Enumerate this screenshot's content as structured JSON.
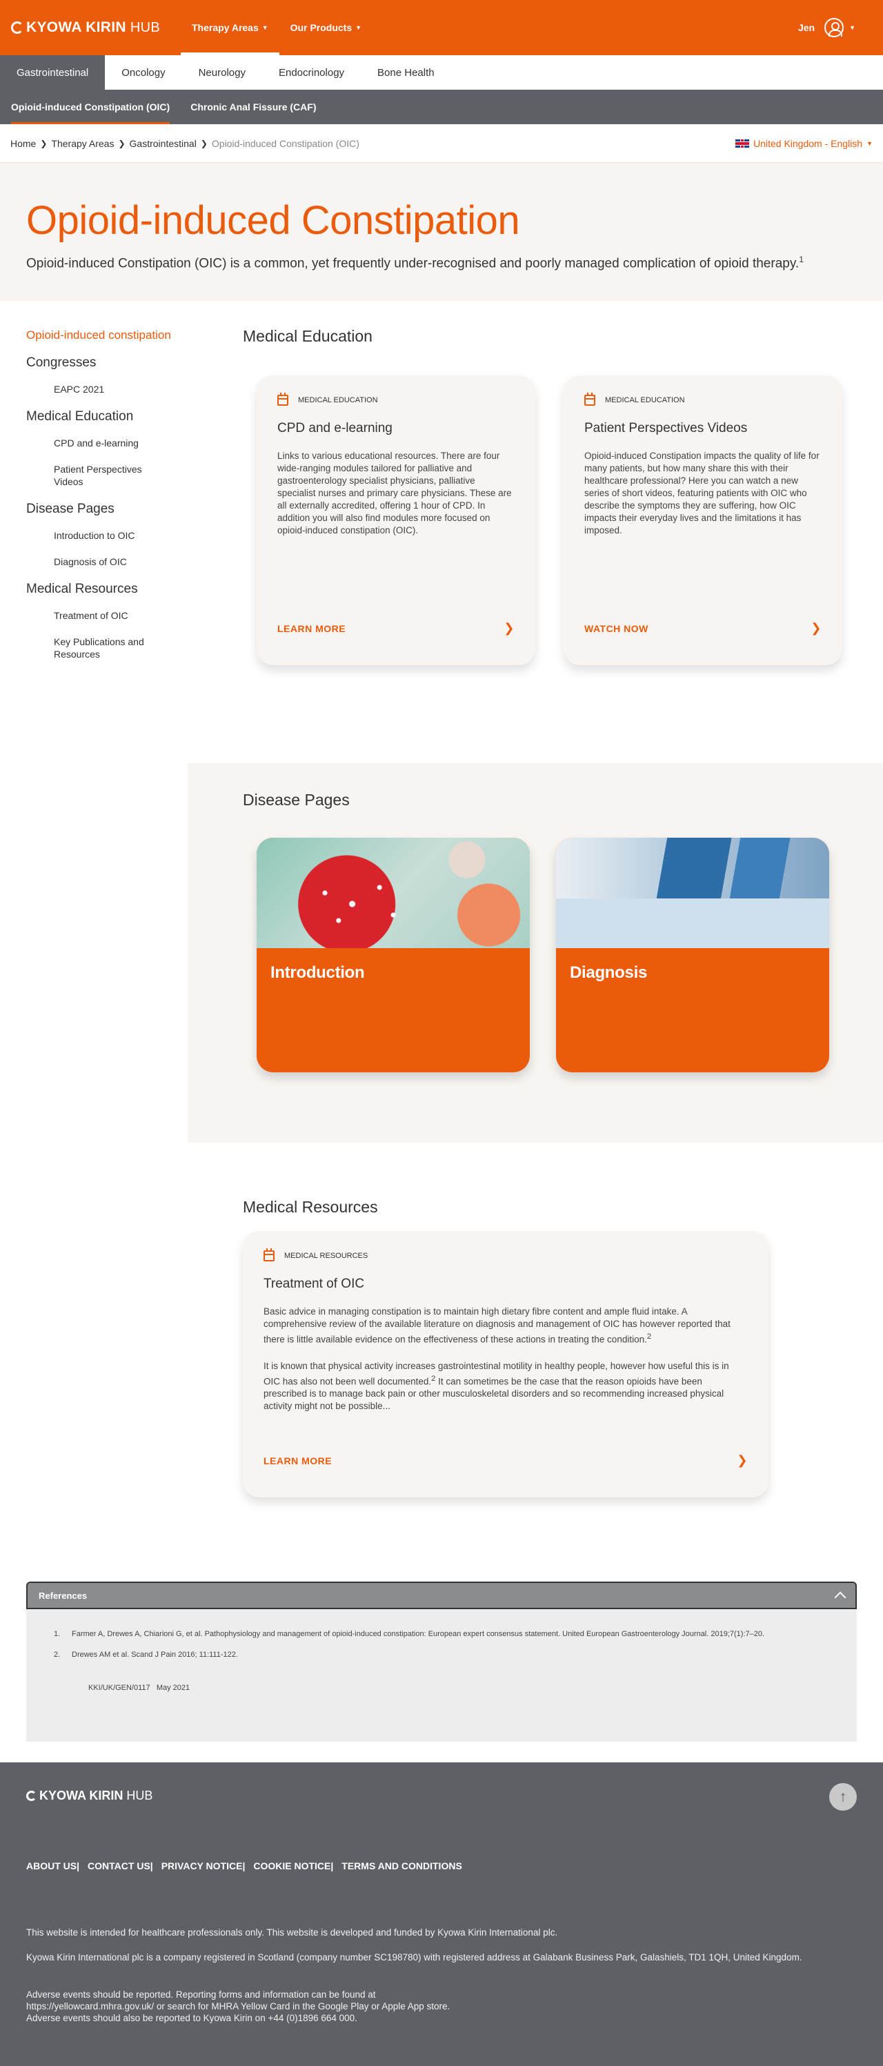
{
  "header": {
    "logo_main": "KYOWA KIRIN",
    "logo_hub": "HUB",
    "nav": [
      {
        "label": "Therapy Areas"
      },
      {
        "label": "Our Products"
      }
    ],
    "user_name": "Jen"
  },
  "therapy_tabs": [
    "Gastrointestinal",
    "Oncology",
    "Neurology",
    "Endocrinology",
    "Bone Health"
  ],
  "sub_tabs": [
    "Opioid-induced Constipation (OIC)",
    "Chronic Anal Fissure (CAF)"
  ],
  "breadcrumb": [
    "Home",
    "Therapy Areas",
    "Gastrointestinal",
    "Opioid-induced Constipation (OIC)"
  ],
  "region": "United Kingdom - English",
  "hero": {
    "title": "Opioid-induced Constipation",
    "subtitle": "Opioid-induced Constipation (OIC) is a common, yet frequently under-recognised and poorly managed complication of opioid therapy.",
    "sup": "1"
  },
  "leftnav": {
    "top": "Opioid-induced constipation",
    "groups": [
      {
        "label": "Congresses",
        "links": [
          "EAPC 2021"
        ]
      },
      {
        "label": "Medical Education",
        "links": [
          "CPD and e-learning",
          "Patient Perspectives Videos"
        ]
      },
      {
        "label": "Disease Pages",
        "links": [
          "Introduction to OIC",
          "Diagnosis of OIC"
        ]
      },
      {
        "label": "Medical Resources",
        "links": [
          "Treatment of OIC",
          "Key Publications and Resources"
        ]
      }
    ]
  },
  "medical_education": {
    "heading": "Medical Education",
    "cards": [
      {
        "tag": "MEDICAL EDUCATION",
        "title": "CPD and e-learning",
        "body": "Links to various educational resources. There are four wide-ranging modules tailored for palliative and gastroenterology specialist physicians, palliative specialist nurses and primary care physicians. These are all externally accredited, offering 1 hour of CPD. In addition you will also find modules more focused on opioid-induced constipation (OIC).",
        "cta": "LEARN MORE"
      },
      {
        "tag": "MEDICAL EDUCATION",
        "title": "Patient Perspectives Videos",
        "body": "Opioid-induced Constipation impacts the quality of life for many patients, but how many share this with their healthcare professional? Here you can watch a new series of short videos, featuring patients with OIC who describe the symptoms they are suffering, how OIC impacts their everyday lives and the limitations it has imposed.",
        "cta": "WATCH NOW"
      }
    ]
  },
  "disease_pages": {
    "heading": "Disease Pages",
    "cards": [
      {
        "title": "Introduction",
        "image": "cells-image"
      },
      {
        "title": "Diagnosis",
        "image": "lab-monitors-image"
      }
    ]
  },
  "medical_resources": {
    "heading": "Medical Resources",
    "card": {
      "tag": "MEDICAL RESOURCES",
      "title": "Treatment of OIC",
      "p1": "Basic advice in managing constipation is to maintain high dietary fibre content and ample fluid intake. A comprehensive review of the available literature on diagnosis and management of OIC has however reported that there is little available evidence on the effectiveness of these actions in treating the condition.",
      "p1_sup": "2",
      "p2a": "It is known that physical activity increases gastrointestinal motility in healthy people, however how useful this is in OIC has also not been well documented.",
      "p2_sup": "2",
      "p2b": " It can sometimes be the case that the reason opioids have been prescribed is to manage back pain or other musculoskeletal disorders and so recommending increased physical activity might not be possible...",
      "cta": "LEARN MORE"
    }
  },
  "references": {
    "heading": "References",
    "items": [
      {
        "n": "1.",
        "text": "Farmer A, Drewes A, Chiarioni G, et al. Pathophysiology and management of opioid-induced constipation: European expert consensus statement. United European Gastroenterology Journal. 2019;7(1):7–20."
      },
      {
        "n": "2.",
        "text": "Drewes AM et al. Scand J Pain 2016; 11:111-122."
      }
    ],
    "code": "KKI/UK/GEN/0117   May 2021"
  },
  "footer": {
    "logo_main": "KYOWA KIRIN",
    "logo_hub": "HUB",
    "links": [
      "ABOUT US",
      "CONTACT US",
      "PRIVACY NOTICE",
      "COOKIE NOTICE",
      "TERMS AND CONDITIONS"
    ],
    "p1": "This website is intended for healthcare professionals only. This website is developed and funded by Kyowa Kirin International plc.",
    "p2": "Kyowa Kirin International plc is a company registered in Scotland (company number SC198780) with registered address at Galabank Business Park, Galashiels, TD1 1QH, United Kingdom.",
    "p3_1": "Adverse events should be reported. Reporting forms and information can be found at",
    "p3_2": "https://yellowcard.mhra.gov.uk/ or search for MHRA Yellow Card in the Google Play or Apple App store.",
    "p3_3": "Adverse events should also be reported to Kyowa Kirin on +44 (0)1896 664 000."
  },
  "colors": {
    "accent": "#ea5b0c",
    "dark": "#5d6166",
    "card_bg": "#f8f4f1"
  }
}
